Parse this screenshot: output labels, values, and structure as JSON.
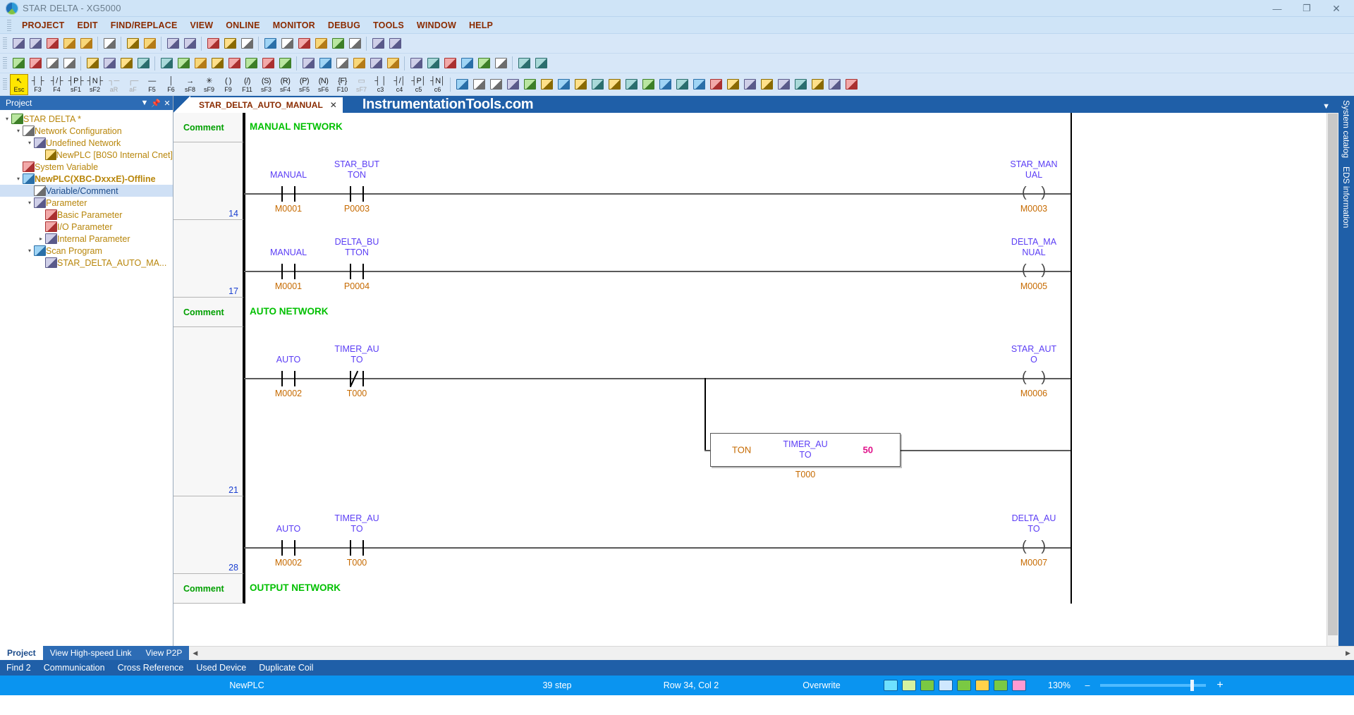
{
  "window": {
    "title": "STAR DELTA - XG5000",
    "logo_icon": "xg5000-logo-icon",
    "buttons": [
      {
        "name": "minimize",
        "glyph": "—"
      },
      {
        "name": "restore",
        "glyph": "❐"
      },
      {
        "name": "close",
        "glyph": "✕"
      }
    ]
  },
  "menu": {
    "items": [
      "PROJECT",
      "EDIT",
      "FIND/REPLACE",
      "VIEW",
      "ONLINE",
      "MONITOR",
      "DEBUG",
      "TOOLS",
      "WINDOW",
      "HELP"
    ]
  },
  "toolbar_row1": {
    "groups": [
      [
        "new-file-icon",
        "open-folder-icon",
        "save-as-icon",
        "save-icon",
        "print-icon"
      ],
      [
        "clipboard-icon"
      ],
      [
        "print-preview-icon",
        "print-setup-icon"
      ],
      [
        "monitor-grid-icon",
        "target-icon"
      ],
      [
        "help-question-icon",
        "doc-compare-icon",
        "s50-icon"
      ],
      [
        "undo-icon",
        "redo-icon",
        "cut-icon",
        "copy-icon",
        "paste-icon",
        "delete-x-icon"
      ],
      [
        "network-node-icon",
        "network-node2-icon"
      ]
    ]
  },
  "toolbar_row2": {
    "groups": [
      [
        "run-icon",
        "stop-icon",
        "pause-icon",
        "debug-step-icon"
      ],
      [
        "online-connect-icon",
        "write-plc-icon",
        "read-plc-icon",
        "compare-plc-icon"
      ],
      [
        "monitor-start-icon",
        "monitor-pause-icon",
        "monitor-stop-icon",
        "force-io-icon",
        "sys-monitor-icon",
        "device-monitor-icon",
        "trend-monitor-icon",
        "close-x-icon"
      ],
      [
        "breakpoint-icon",
        "break-list-icon",
        "run-to-cursor-icon",
        "step-over-icon",
        "step-into-icon",
        "step-out-icon"
      ],
      [
        "find-icon",
        "find-next-icon",
        "find-device-icon",
        "replace-icon",
        "goto-icon",
        "bookmark-icon"
      ],
      [
        "prev-arrow-icon",
        "next-arrow-icon"
      ]
    ]
  },
  "ladder_toolbar": {
    "tools": [
      {
        "glyph": "↖",
        "key": "Esc",
        "name": "select-tool",
        "dim": false,
        "highlight": true
      },
      {
        "glyph": "┤ ├",
        "key": "F3",
        "name": "no-contact-tool",
        "dim": false
      },
      {
        "glyph": "┤/├",
        "key": "F4",
        "name": "nc-contact-tool",
        "dim": false
      },
      {
        "glyph": "┤P├",
        "key": "sF1",
        "name": "positive-pulse-contact-tool",
        "dim": false
      },
      {
        "glyph": "┤N├",
        "key": "sF2",
        "name": "negative-pulse-contact-tool",
        "dim": false
      },
      {
        "glyph": "┐─",
        "key": "aR",
        "name": "rising-edge-tool",
        "dim": true
      },
      {
        "glyph": "┌─",
        "key": "aF",
        "name": "falling-edge-tool",
        "dim": true
      },
      {
        "glyph": "—",
        "key": "F5",
        "name": "horizontal-line-tool",
        "dim": false
      },
      {
        "glyph": "│",
        "key": "F6",
        "name": "vertical-line-tool",
        "dim": false
      },
      {
        "glyph": "→",
        "key": "sF8",
        "name": "right-line-tool",
        "dim": false
      },
      {
        "glyph": "✳",
        "key": "sF9",
        "name": "delete-line-tool",
        "dim": false
      },
      {
        "glyph": "( )",
        "key": "F9",
        "name": "coil-tool",
        "dim": false
      },
      {
        "glyph": "(/)",
        "key": "F11",
        "name": "inverted-coil-tool",
        "dim": false
      },
      {
        "glyph": "(S)",
        "key": "sF3",
        "name": "set-coil-tool",
        "dim": false
      },
      {
        "glyph": "(R)",
        "key": "sF4",
        "name": "reset-coil-tool",
        "dim": false
      },
      {
        "glyph": "(P)",
        "key": "sF5",
        "name": "positive-coil-tool",
        "dim": false
      },
      {
        "glyph": "(N)",
        "key": "sF6",
        "name": "negative-coil-tool",
        "dim": false
      },
      {
        "glyph": "{F}",
        "key": "F10",
        "name": "function-block-tool",
        "dim": false
      },
      {
        "glyph": "▭",
        "key": "sF7",
        "name": "fb-instance-tool",
        "dim": true
      },
      {
        "glyph": "┤ │",
        "key": "c3",
        "name": "compare-contact-tool",
        "dim": false
      },
      {
        "glyph": "┤/│",
        "key": "c4",
        "name": "compare-ncontact-tool",
        "dim": false
      },
      {
        "glyph": "┤P│",
        "key": "c5",
        "name": "compare-p-tool",
        "dim": false
      },
      {
        "glyph": "┤N│",
        "key": "c6",
        "name": "compare-n-tool",
        "dim": false
      }
    ],
    "extra_icons": [
      "paste-sm-icon",
      "view-list-icon",
      "view-grid-icon",
      "view-detail-icon",
      "view-large-icon",
      "view-fn-icon",
      "fb-lib-icon",
      "var-table-icon",
      "device-table-icon",
      "check-m-icon",
      "check-d-icon",
      "check-p-icon",
      "check-a-icon",
      "zoom-in-icon",
      "zoom-out-icon",
      "run-mon-icon",
      "doc-icon",
      "win-split-icon",
      "help1-icon",
      "help2-icon",
      "tag1-icon",
      "tag2-icon",
      "tag3-icon",
      "tag4-icon"
    ]
  },
  "project_panel": {
    "title": "Project",
    "header_buttons": [
      "dropdown-icon",
      "pin-icon",
      "close-icon"
    ],
    "tree": [
      {
        "label": "STAR DELTA *",
        "indent": 0,
        "icon": "plc-project-icon",
        "twisty": "▾",
        "selected": false,
        "bold": false
      },
      {
        "label": "Network Configuration",
        "indent": 1,
        "icon": "network-icon",
        "twisty": "▾",
        "selected": false,
        "bold": false
      },
      {
        "label": "Undefined Network",
        "indent": 2,
        "icon": "undefined-network-icon",
        "twisty": "▾",
        "selected": false,
        "bold": false
      },
      {
        "label": "NewPLC [B0S0 Internal Cnet]",
        "indent": 3,
        "icon": "plc-node-icon",
        "twisty": "",
        "selected": false,
        "bold": false
      },
      {
        "label": "System Variable",
        "indent": 1,
        "icon": "system-variable-icon",
        "twisty": "",
        "selected": false,
        "bold": false
      },
      {
        "label": "NewPLC(XBC-DxxxE)-Offline",
        "indent": 1,
        "icon": "plc-device-icon",
        "twisty": "▾",
        "selected": false,
        "bold": true
      },
      {
        "label": "Variable/Comment",
        "indent": 2,
        "icon": "variable-comment-icon",
        "twisty": "",
        "selected": true,
        "bold": false
      },
      {
        "label": "Parameter",
        "indent": 2,
        "icon": "parameter-icon",
        "twisty": "▾",
        "selected": false,
        "bold": false
      },
      {
        "label": "Basic Parameter",
        "indent": 3,
        "icon": "basic-parameter-icon",
        "twisty": "",
        "selected": false,
        "bold": false
      },
      {
        "label": "I/O Parameter",
        "indent": 3,
        "icon": "io-parameter-icon",
        "twisty": "",
        "selected": false,
        "bold": false
      },
      {
        "label": "Internal Parameter",
        "indent": 3,
        "icon": "internal-parameter-icon",
        "twisty": "▸",
        "selected": false,
        "bold": false
      },
      {
        "label": "Scan Program",
        "indent": 2,
        "icon": "scan-program-icon",
        "twisty": "▾",
        "selected": false,
        "bold": false
      },
      {
        "label": "STAR_DELTA_AUTO_MA...",
        "indent": 3,
        "icon": "ladder-program-icon",
        "twisty": "",
        "selected": false,
        "bold": false
      }
    ]
  },
  "editor": {
    "tab_label": "STAR_DELTA_AUTO_MANUAL",
    "tab_close": "✕",
    "watermark": "InstrumentationTools.com",
    "dropdown_caret": "▼"
  },
  "ladder": {
    "comment_label": "Comment",
    "networks": [
      {
        "comment": "MANUAL NETWORK"
      },
      {
        "comment": "AUTO NETWORK"
      },
      {
        "comment": "OUTPUT NETWORK"
      }
    ],
    "rungs": [
      {
        "number": "14",
        "contacts": [
          {
            "label": "MANUAL",
            "device": "M0001",
            "type": "no"
          },
          {
            "label": "STAR_BUT\nTON",
            "device": "P0003",
            "type": "no"
          }
        ],
        "coil": {
          "label": "STAR_MAN\nUAL",
          "device": "M0003"
        }
      },
      {
        "number": "17",
        "contacts": [
          {
            "label": "MANUAL",
            "device": "M0001",
            "type": "no"
          },
          {
            "label": "DELTA_BU\nTTON",
            "device": "P0004",
            "type": "no"
          }
        ],
        "coil": {
          "label": "DELTA_MA\nNUAL",
          "device": "M0005"
        }
      },
      {
        "number": "21",
        "contacts": [
          {
            "label": "AUTO",
            "device": "M0002",
            "type": "no"
          },
          {
            "label": "TIMER_AU\nTO",
            "device": "T000",
            "type": "nc"
          }
        ],
        "coil": {
          "label": "STAR_AUT\nO",
          "device": "M0006"
        },
        "function_block": {
          "instruction": "TON",
          "name": "TIMER_AU\nTO",
          "preset": "50",
          "device": "T000"
        }
      },
      {
        "number": "28",
        "contacts": [
          {
            "label": "AUTO",
            "device": "M0002",
            "type": "no"
          },
          {
            "label": "TIMER_AU\nTO",
            "device": "T000",
            "type": "no"
          }
        ],
        "coil": {
          "label": "DELTA_AU\nTO",
          "device": "M0007"
        }
      }
    ]
  },
  "right_dock": {
    "tabs": [
      "System catalog",
      "EDS information"
    ]
  },
  "bottom": {
    "panel_tabs": [
      {
        "label": "Project",
        "active": true
      },
      {
        "label": "View High-speed Link",
        "active": false
      },
      {
        "label": "View P2P",
        "active": false
      }
    ],
    "result_tabs": [
      "Find 2",
      "Communication",
      "Cross Reference",
      "Used Device",
      "Duplicate Coil"
    ]
  },
  "status_bar": {
    "plc": "NewPLC",
    "steps": "39 step",
    "cursor": "Row 34, Col 2",
    "mode": "Overwrite",
    "icons": [
      "lock-icon",
      "network-status-icon",
      "m-device-icon",
      "d-device-icon",
      "iv-device-icon",
      "dc-device-icon",
      "vc-device-icon",
      "a-device-icon"
    ],
    "zoom": "130%",
    "zoom_minus": "–",
    "zoom_plus": "+"
  },
  "colors": {
    "title_bar": "#cfe4f7",
    "menu_text": "#8a2b00",
    "toolbar_bg": "#d7e7f8",
    "panel_header": "#2d6cb5",
    "tab_strip": "#1f5fa8",
    "status_bar": "#0a94f0",
    "comment_green": "#00c000",
    "label_blue": "#5b3df5",
    "device_orange": "#c66a00",
    "preset_magenta": "#e0118a",
    "rung_number": "#1a3fd0",
    "tree_label": "#b8860b",
    "selection": "#cfe0f5"
  }
}
